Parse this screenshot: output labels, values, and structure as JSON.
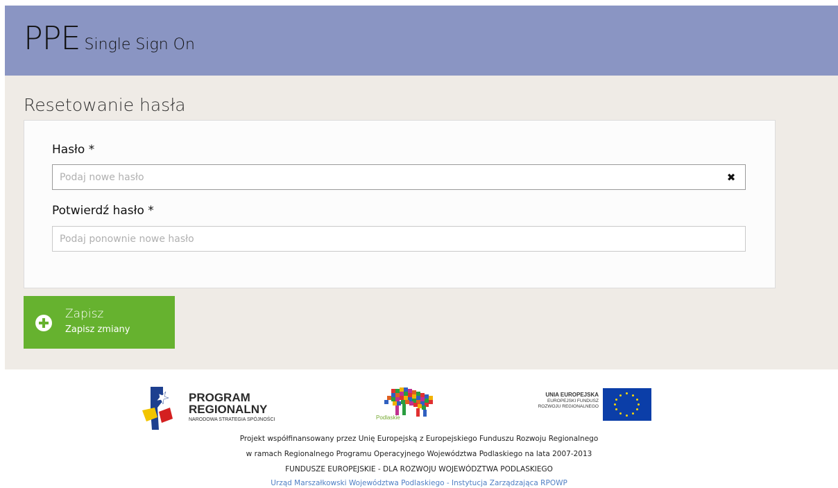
{
  "header": {
    "brand": "PPE",
    "subtitle": "Single Sign On"
  },
  "page": {
    "title": "Resetowanie hasła"
  },
  "form": {
    "password_label": "Hasło *",
    "password_placeholder": "Podaj nowe hasło",
    "confirm_label": "Potwierdź hasło *",
    "confirm_placeholder": "Podaj ponownie nowe hasło",
    "clear_glyph": "✖"
  },
  "save_button": {
    "title": "Zapisz",
    "subtitle": "Zapisz zmiany"
  },
  "footer": {
    "program_line1": "PROGRAM",
    "program_line2": "REGIONALNY",
    "program_line3": "NARODOWA STRATEGIA SPÓJNOŚCI",
    "podlaskie": "Podlaskie",
    "ue_line1": "UNIA EUROPEJSKA",
    "ue_line2": "EUROPEJSKI FUNDUSZ",
    "ue_line3": "ROZWOJU REGIONALNEGO",
    "line1": "Projekt współfinansowany przez Unię Europejską z Europejskiego Funduszu Rozwoju Regionalnego",
    "line2": "w ramach Regionalnego Programu Operacyjnego Województwa Podlaskiego na lata 2007-2013",
    "line3": "FUNDUSZE EUROPEJSKIE - DLA ROZWOJU WOJEWÓDZTWA PODLASKIEGO",
    "link": "Urząd Marszałkowski Województwa Podlaskiego - Instytucja Zarządzająca RPOWP"
  },
  "colors": {
    "header": "#8a95c3",
    "content_bg": "#efebe6",
    "save_button": "#66b22f",
    "link": "#4f7fc4"
  }
}
